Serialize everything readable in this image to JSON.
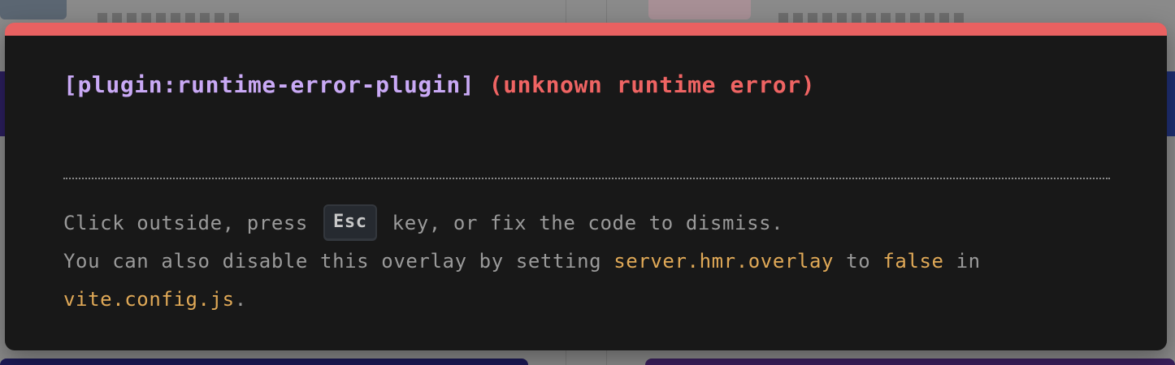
{
  "overlay": {
    "plugin": "[plugin:runtime-error-plugin]",
    "message": "(unknown runtime error)",
    "tip": {
      "line1_before": "Click outside, press ",
      "key": "Esc",
      "line1_after": " key, or fix the code to dismiss.",
      "line2_before": "You can also disable this overlay by setting ",
      "setting_name": "server.hmr.overlay",
      "line2_middle": " to ",
      "setting_value": "false",
      "line2_after": " in",
      "config_file": "vite.config.js",
      "line3_after": "."
    }
  },
  "colors": {
    "accent_bar": "#e86161",
    "plugin_text": "#c9a9f5",
    "error_text": "#ef6463",
    "code_text": "#e0a957",
    "panel_bg": "#181818"
  }
}
